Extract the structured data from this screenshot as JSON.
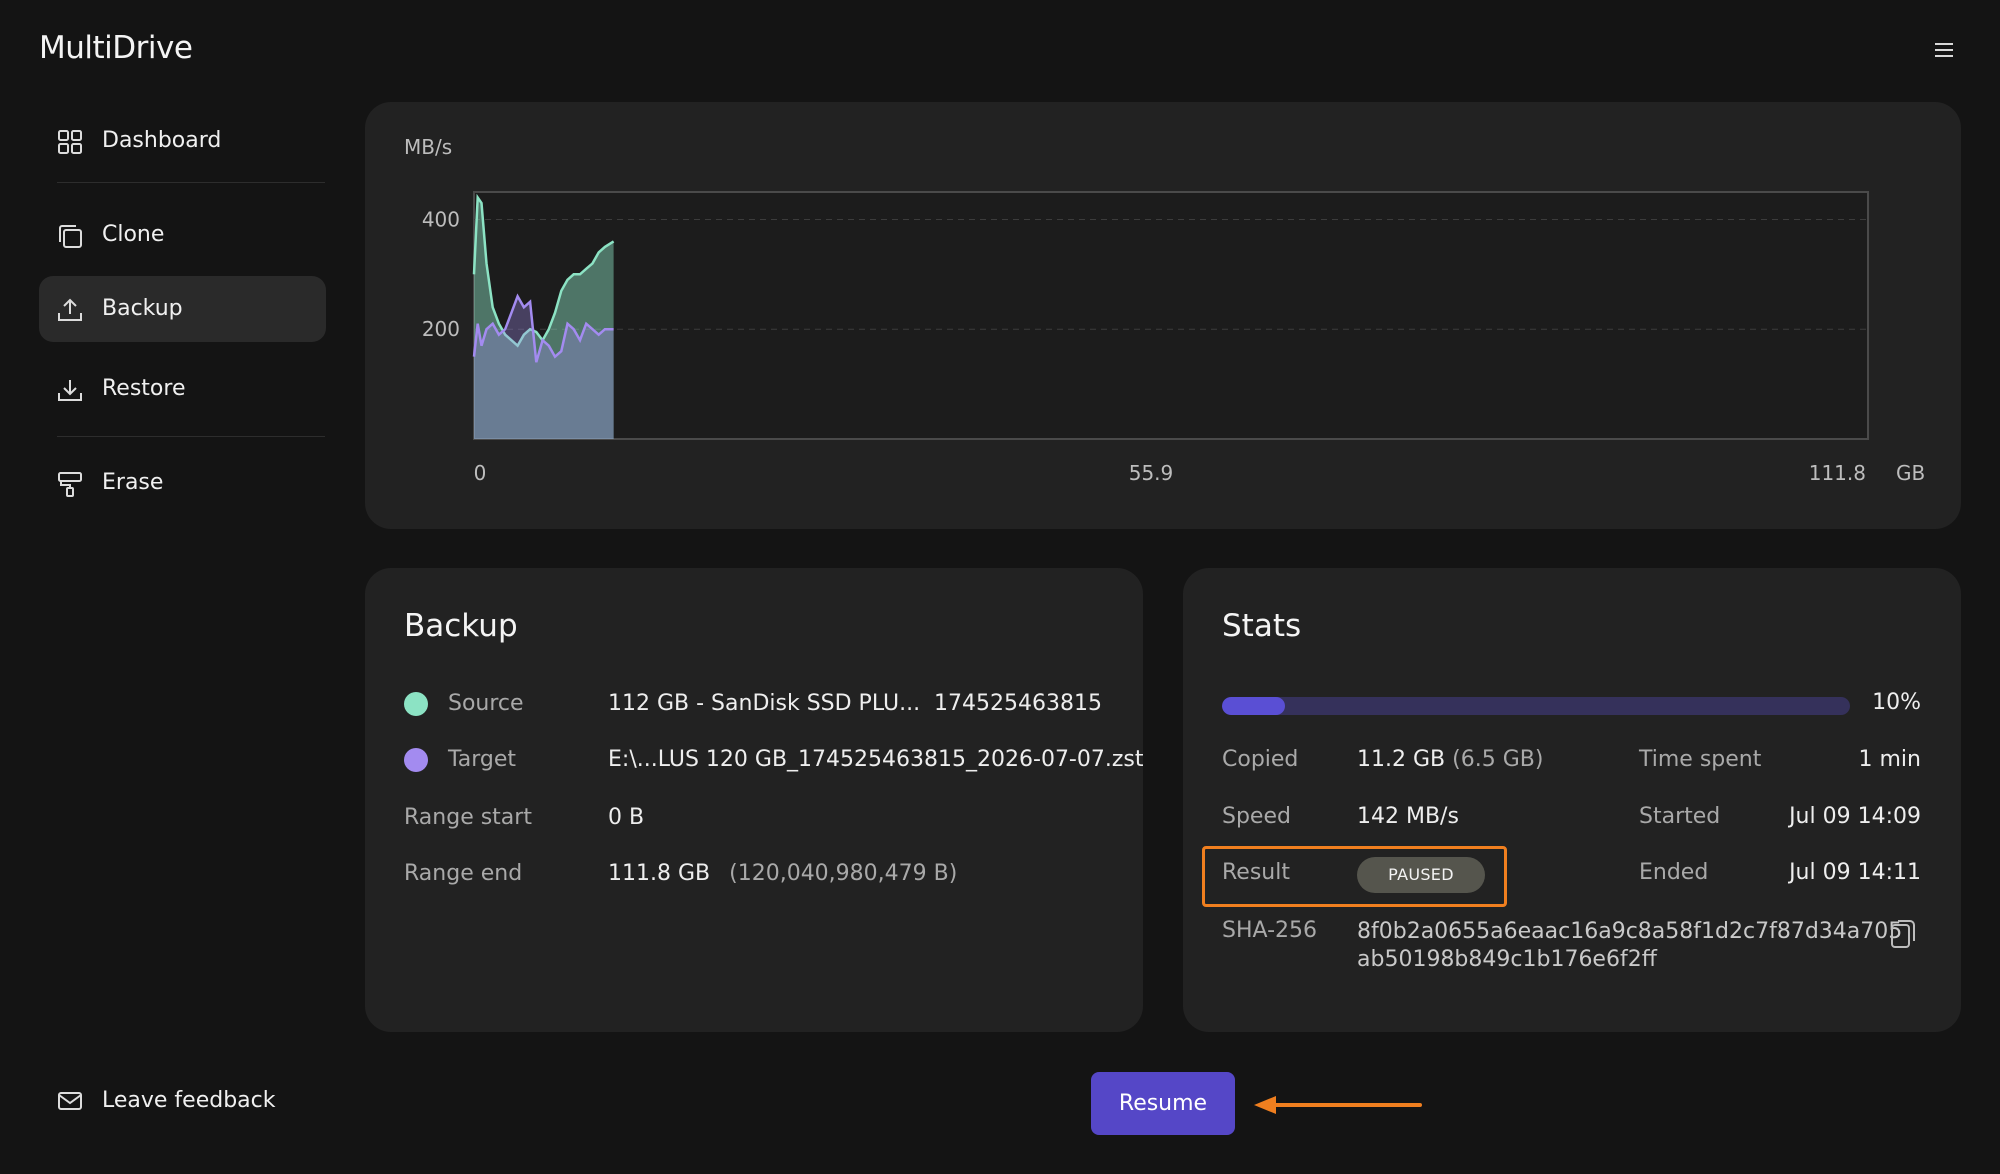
{
  "app": {
    "title": "MultiDrive"
  },
  "sidebar": {
    "items": [
      {
        "label": "Dashboard",
        "icon": "grid-icon",
        "active": false
      },
      {
        "label": "Clone",
        "icon": "copy-icon",
        "active": false
      },
      {
        "label": "Backup",
        "icon": "upload-icon",
        "active": true
      },
      {
        "label": "Restore",
        "icon": "download-icon",
        "active": false
      },
      {
        "label": "Erase",
        "icon": "paint-roller-icon",
        "active": false
      }
    ],
    "feedback_label": "Leave feedback"
  },
  "chart_data": {
    "type": "area",
    "ylabel": "MB/s",
    "xlabel": "GB",
    "xlim": [
      0,
      111.8
    ],
    "ylim": [
      0,
      450
    ],
    "y_ticks": [
      200,
      400
    ],
    "x_ticks": [
      "0",
      "55.9",
      "111.8"
    ],
    "x_unit": "GB",
    "grid": true,
    "series": [
      {
        "color": "#8ce3c4",
        "x": [
          0,
          0.3,
          0.6,
          1.0,
          1.5,
          2.0,
          2.5,
          3.0,
          3.5,
          4.0,
          4.5,
          5.0,
          5.5,
          6.0,
          6.5,
          7.0,
          7.5,
          8.0,
          8.5,
          9.0,
          9.5,
          10.0,
          10.5,
          11.2
        ],
        "values": [
          300,
          440,
          430,
          320,
          240,
          210,
          190,
          180,
          170,
          190,
          200,
          195,
          180,
          200,
          230,
          270,
          290,
          300,
          300,
          310,
          320,
          340,
          350,
          360
        ]
      },
      {
        "color": "#a38bf0",
        "x": [
          0,
          0.3,
          0.6,
          1.0,
          1.5,
          2.0,
          2.5,
          3.0,
          3.5,
          4.0,
          4.5,
          5.0,
          5.5,
          6.0,
          6.5,
          7.0,
          7.5,
          8.0,
          8.5,
          9.0,
          9.5,
          10.0,
          10.5,
          11.2
        ],
        "values": [
          150,
          210,
          170,
          200,
          210,
          190,
          200,
          230,
          260,
          240,
          250,
          140,
          180,
          170,
          150,
          160,
          210,
          200,
          180,
          210,
          200,
          190,
          200,
          200
        ]
      }
    ]
  },
  "backup": {
    "title": "Backup",
    "source_label": "Source",
    "source_value": "112 GB - SanDisk SSD PLU...",
    "source_serial": "174525463815",
    "source_color": "#8ce3c4",
    "target_label": "Target",
    "target_value": "E:\\...LUS 120 GB_174525463815_2026-07-07.zst",
    "target_color": "#a38bf0",
    "range_start_label": "Range start",
    "range_start_value": "0 B",
    "range_end_label": "Range end",
    "range_end_value": "111.8 GB",
    "range_end_bytes": "(120,040,980,479 B)"
  },
  "stats": {
    "title": "Stats",
    "progress_percent": 10,
    "progress_label": "10%",
    "copied_label": "Copied",
    "copied_value": "11.2 GB",
    "copied_compressed": "(6.5 GB)",
    "speed_label": "Speed",
    "speed_value": "142 MB/s",
    "result_label": "Result",
    "result_value": "PAUSED",
    "time_spent_label": "Time spent",
    "time_spent_value": "1 min",
    "started_label": "Started",
    "started_value": "Jul 09 14:09",
    "ended_label": "Ended",
    "ended_value": "Jul 09 14:11",
    "hash_label": "SHA-256",
    "hash_line1": "8f0b2a0655a6eaac16a9c8a58f1d2c7f87d34a705",
    "hash_line2": "ab50198b849c1b176e6f2ff"
  },
  "actions": {
    "resume_label": "Resume"
  },
  "colors": {
    "accent": "#5547c7",
    "highlight": "#f07f1f",
    "background": "#141414",
    "panel": "#222222"
  }
}
